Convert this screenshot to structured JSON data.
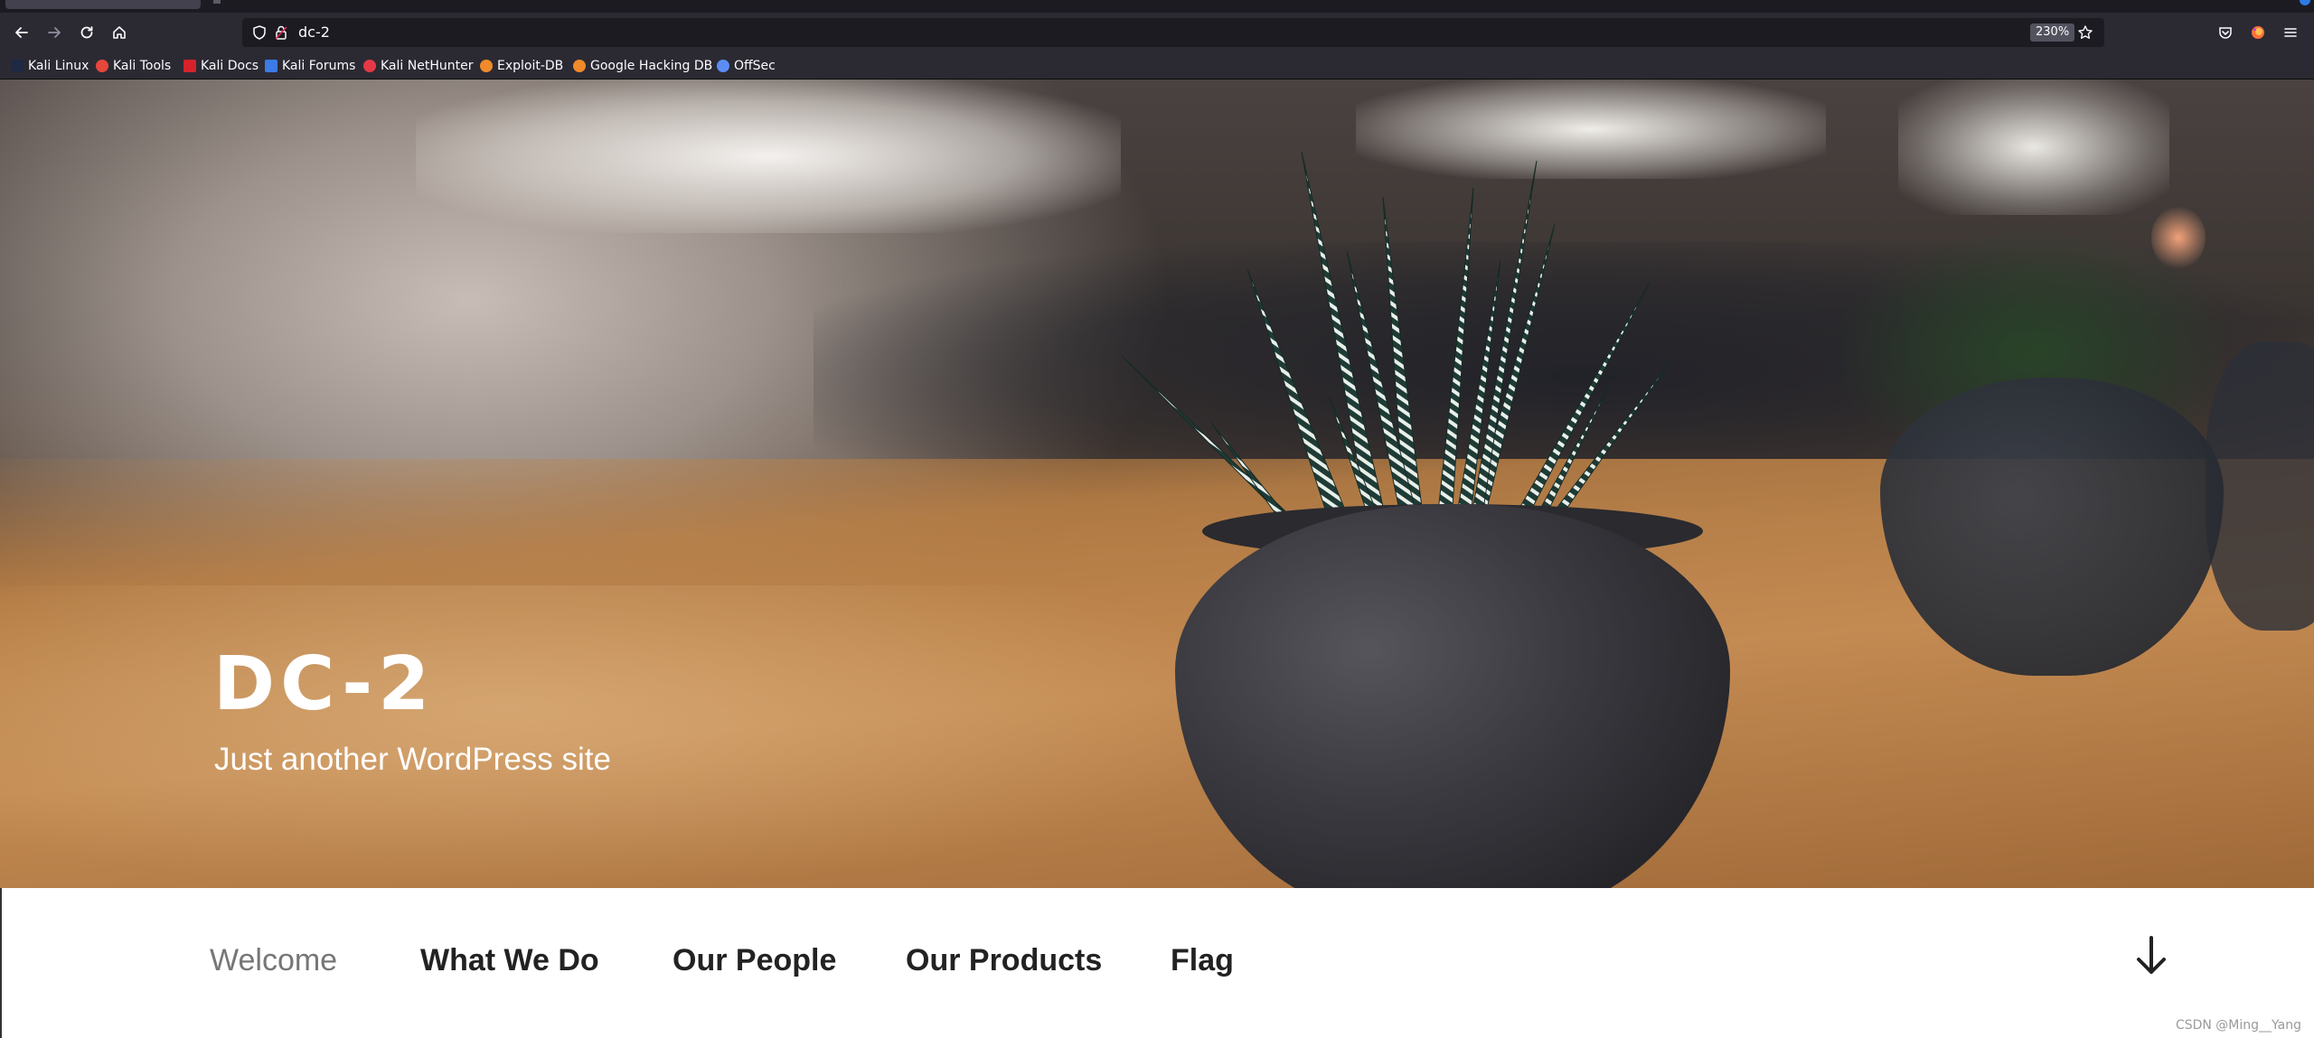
{
  "browser": {
    "url": "dc-2",
    "zoom": "230%",
    "bookmarks": [
      {
        "label": "Kali Linux",
        "icon": "kali-dragon-icon",
        "color": "#2f6fd6"
      },
      {
        "label": "Kali Tools",
        "icon": "kali-tools-icon",
        "color": "#e6473b"
      },
      {
        "label": "Kali Docs",
        "icon": "kali-docs-icon",
        "color": "#d6232b"
      },
      {
        "label": "Kali Forums",
        "icon": "kali-forums-icon",
        "color": "#3b7be5"
      },
      {
        "label": "Kali NetHunter",
        "icon": "nethunter-icon",
        "color": "#e63946"
      },
      {
        "label": "Exploit-DB",
        "icon": "exploit-db-icon",
        "color": "#f08a2a"
      },
      {
        "label": "Google Hacking DB",
        "icon": "ghdb-icon",
        "color": "#f08a2a"
      },
      {
        "label": "OffSec",
        "icon": "offsec-icon",
        "color": "#5b8df5"
      }
    ]
  },
  "site": {
    "title": "DC-2",
    "tagline": "Just another WordPress site"
  },
  "menu": {
    "items": [
      {
        "label": "Welcome",
        "current": true
      },
      {
        "label": "What We Do",
        "current": false
      },
      {
        "label": "Our People",
        "current": false
      },
      {
        "label": "Our Products",
        "current": false
      },
      {
        "label": "Flag",
        "current": false
      }
    ]
  },
  "watermark": "CSDN @Ming__Yang"
}
